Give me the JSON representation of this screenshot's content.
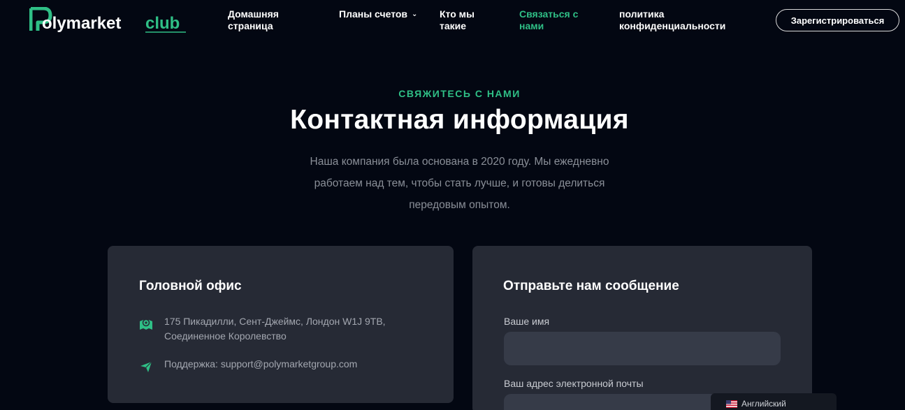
{
  "header": {
    "logo": {
      "main": "Polymarket",
      "accent": "club",
      "accent_color": "#2fbf86"
    },
    "nav": [
      {
        "label_line1": "Домашняя",
        "label_line2": "страница",
        "active": false
      },
      {
        "label_line1": "Планы счетов",
        "label_line2": "",
        "has_dropdown": true,
        "active": false
      },
      {
        "label_line1": "Кто мы",
        "label_line2": "такие",
        "active": false
      },
      {
        "label_line1": "Связаться с",
        "label_line2": "нами",
        "active": true
      },
      {
        "label_line1": "политика",
        "label_line2": "конфиденциальности",
        "active": false
      }
    ],
    "signup_label": "Зарегистрироваться"
  },
  "hero": {
    "eyebrow": "СВЯЖИТЕСЬ С НАМИ",
    "title": "Контактная информация",
    "lead": "Наша компания была основана в 2020 году. Мы ежедневно работаем над тем, чтобы стать лучше, и готовы делиться передовым опытом."
  },
  "office": {
    "title": "Головной офис",
    "address_line1": "175 Пикадилли, Сент-Джеймс, Лондон W1J 9TB,",
    "address_line2": "Соединенное Королевство",
    "address_icon": "map-pin-icon",
    "support": "Поддержка: support@polymarketgroup.com",
    "support_icon": "send-icon"
  },
  "form": {
    "title": "Отправьте нам сообщение",
    "name_label": "Ваше имя",
    "name_value": "",
    "email_label": "Ваш адрес электронной почты",
    "email_value": ""
  },
  "language": {
    "label": "Английский",
    "icon": "us-flag-icon"
  },
  "colors": {
    "background": "#030712",
    "card": "#262a35",
    "input": "#363b48",
    "accent": "#2fbf86"
  }
}
